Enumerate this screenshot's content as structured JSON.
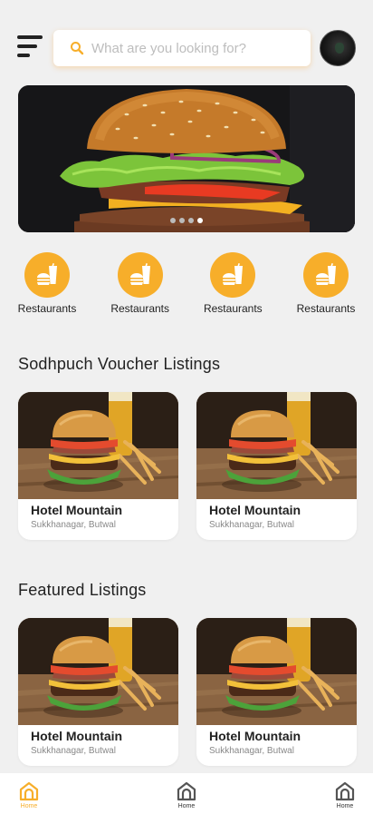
{
  "header": {
    "menu_icon": "hamburger-menu-icon",
    "search_placeholder": "What are you looking for?",
    "search_icon": "search-icon",
    "avatar": "user-avatar"
  },
  "banner": {
    "slides": 4,
    "active_slide": 4
  },
  "categories": [
    {
      "label": "Restaurants",
      "icon": "fastfood-icon"
    },
    {
      "label": "Restaurants",
      "icon": "fastfood-icon"
    },
    {
      "label": "Restaurants",
      "icon": "fastfood-icon"
    },
    {
      "label": "Restaurants",
      "icon": "fastfood-icon"
    }
  ],
  "voucher_section": {
    "title": "Sodhpuch Voucher Listings",
    "cards": [
      {
        "title": "Hotel Mountain",
        "location": "Sukkhanagar, Butwal"
      },
      {
        "title": "Hotel Mountain",
        "location": "Sukkhanagar, Butwal"
      }
    ]
  },
  "featured_section": {
    "title": "Featured Listings",
    "cards": [
      {
        "title": "Hotel Mountain",
        "location": "Sukkhanagar, Butwal"
      },
      {
        "title": "Hotel Mountain",
        "location": "Sukkhanagar, Butwal"
      }
    ]
  },
  "bottom_nav": [
    {
      "label": "Home",
      "icon": "home-icon",
      "active": true
    },
    {
      "label": "Home",
      "icon": "home-icon",
      "active": false
    },
    {
      "label": "Home",
      "icon": "home-icon",
      "active": false
    }
  ],
  "colors": {
    "accent": "#f7ae2a",
    "background": "#f0f0f0",
    "card": "#ffffff"
  }
}
